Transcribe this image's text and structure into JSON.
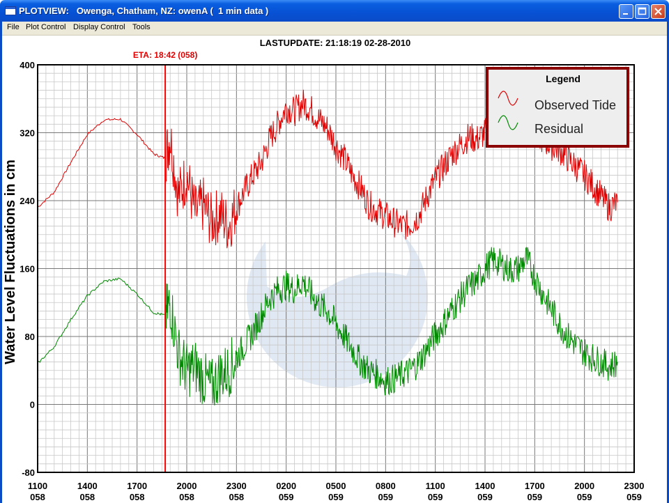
{
  "window": {
    "title": "PLOTVIEW:   Owenga, Chatham, NZ: owenA (  1 min data )"
  },
  "menu": [
    "File",
    "Plot Control",
    "Display Control",
    "Tools"
  ],
  "header": {
    "last_update": "LASTUPDATE: 21:18:19  02-28-2010"
  },
  "eta": {
    "label": "ETA: 18:42 (058)",
    "color": "#ff0000"
  },
  "legend": {
    "title": "Legend",
    "items": [
      "Observed Tide",
      "Residual"
    ]
  },
  "chart_data": {
    "type": "line",
    "ylabel": "Water Level Fluctuations in cm",
    "ylim": [
      -80,
      400
    ],
    "y_ticks": [
      "400",
      "320",
      "240",
      "160",
      "80",
      "0",
      "-80"
    ],
    "x_ticks": [
      {
        "time": "1100",
        "day": "058"
      },
      {
        "time": "1400",
        "day": "058"
      },
      {
        "time": "1700",
        "day": "058"
      },
      {
        "time": "2000",
        "day": "058"
      },
      {
        "time": "2300",
        "day": "058"
      },
      {
        "time": "0200",
        "day": "059"
      },
      {
        "time": "0500",
        "day": "059"
      },
      {
        "time": "0800",
        "day": "059"
      },
      {
        "time": "1100",
        "day": "059"
      },
      {
        "time": "1400",
        "day": "059"
      },
      {
        "time": "1700",
        "day": "059"
      },
      {
        "time": "2000",
        "day": "059"
      },
      {
        "time": "2300",
        "day": "059"
      }
    ],
    "x_range_hours": [
      0,
      36
    ],
    "eta_hour": 7.7,
    "series": [
      {
        "name": "Observed Tide",
        "color": "#e00000",
        "x": [
          0,
          1,
          2,
          3,
          4,
          5,
          6,
          7,
          7.7,
          8,
          8.5,
          9,
          9.5,
          10,
          10.5,
          11,
          11.5,
          12,
          12.5,
          13,
          13.5,
          14,
          14.5,
          15,
          15.5,
          16,
          16.5,
          17,
          17.5,
          18,
          18.5,
          19,
          19.5,
          20,
          20.5,
          21,
          21.5,
          22,
          22.5,
          23,
          23.5,
          24,
          24.5,
          25,
          25.5,
          26,
          26.5,
          27,
          27.5,
          28,
          28.5,
          29,
          29.5,
          30,
          30.5,
          31,
          31.5,
          32,
          32.5,
          33,
          33.5,
          34,
          34.5,
          35
        ],
        "y": [
          232,
          250,
          285,
          318,
          335,
          336,
          318,
          295,
          290,
          315,
          245,
          270,
          225,
          235,
          215,
          225,
          210,
          232,
          252,
          270,
          285,
          312,
          330,
          350,
          345,
          355,
          348,
          335,
          325,
          305,
          290,
          270,
          255,
          235,
          228,
          222,
          215,
          210,
          212,
          222,
          245,
          265,
          280,
          295,
          305,
          315,
          312,
          320,
          325,
          330,
          335,
          330,
          325,
          320,
          312,
          305,
          300,
          290,
          280,
          270,
          258,
          245,
          232,
          238
        ]
      },
      {
        "name": "Residual",
        "color": "#008800",
        "x": [
          0,
          1,
          2,
          3,
          4,
          5,
          6,
          7,
          7.7,
          8,
          8.5,
          9,
          9.5,
          10,
          10.5,
          11,
          11.5,
          12,
          12.5,
          13,
          13.5,
          14,
          14.5,
          15,
          15.5,
          16,
          16.5,
          17,
          17.5,
          18,
          18.5,
          19,
          19.5,
          20,
          20.5,
          21,
          21.5,
          22,
          22.5,
          23,
          23.5,
          24,
          24.5,
          25,
          25.5,
          26,
          26.5,
          27,
          27.5,
          28,
          28.5,
          29,
          29.5,
          30,
          30.5,
          31,
          31.5,
          32,
          32.5,
          33,
          33.5,
          34,
          34.5,
          35
        ],
        "y": [
          48,
          68,
          100,
          128,
          145,
          148,
          130,
          108,
          105,
          120,
          60,
          40,
          45,
          30,
          20,
          35,
          40,
          55,
          70,
          85,
          105,
          125,
          135,
          140,
          135,
          145,
          130,
          118,
          110,
          95,
          80,
          65,
          50,
          40,
          35,
          28,
          30,
          35,
          40,
          50,
          65,
          82,
          95,
          112,
          125,
          138,
          145,
          160,
          170,
          165,
          158,
          160,
          172,
          150,
          130,
          112,
          95,
          80,
          70,
          62,
          55,
          50,
          45,
          50
        ]
      }
    ]
  }
}
